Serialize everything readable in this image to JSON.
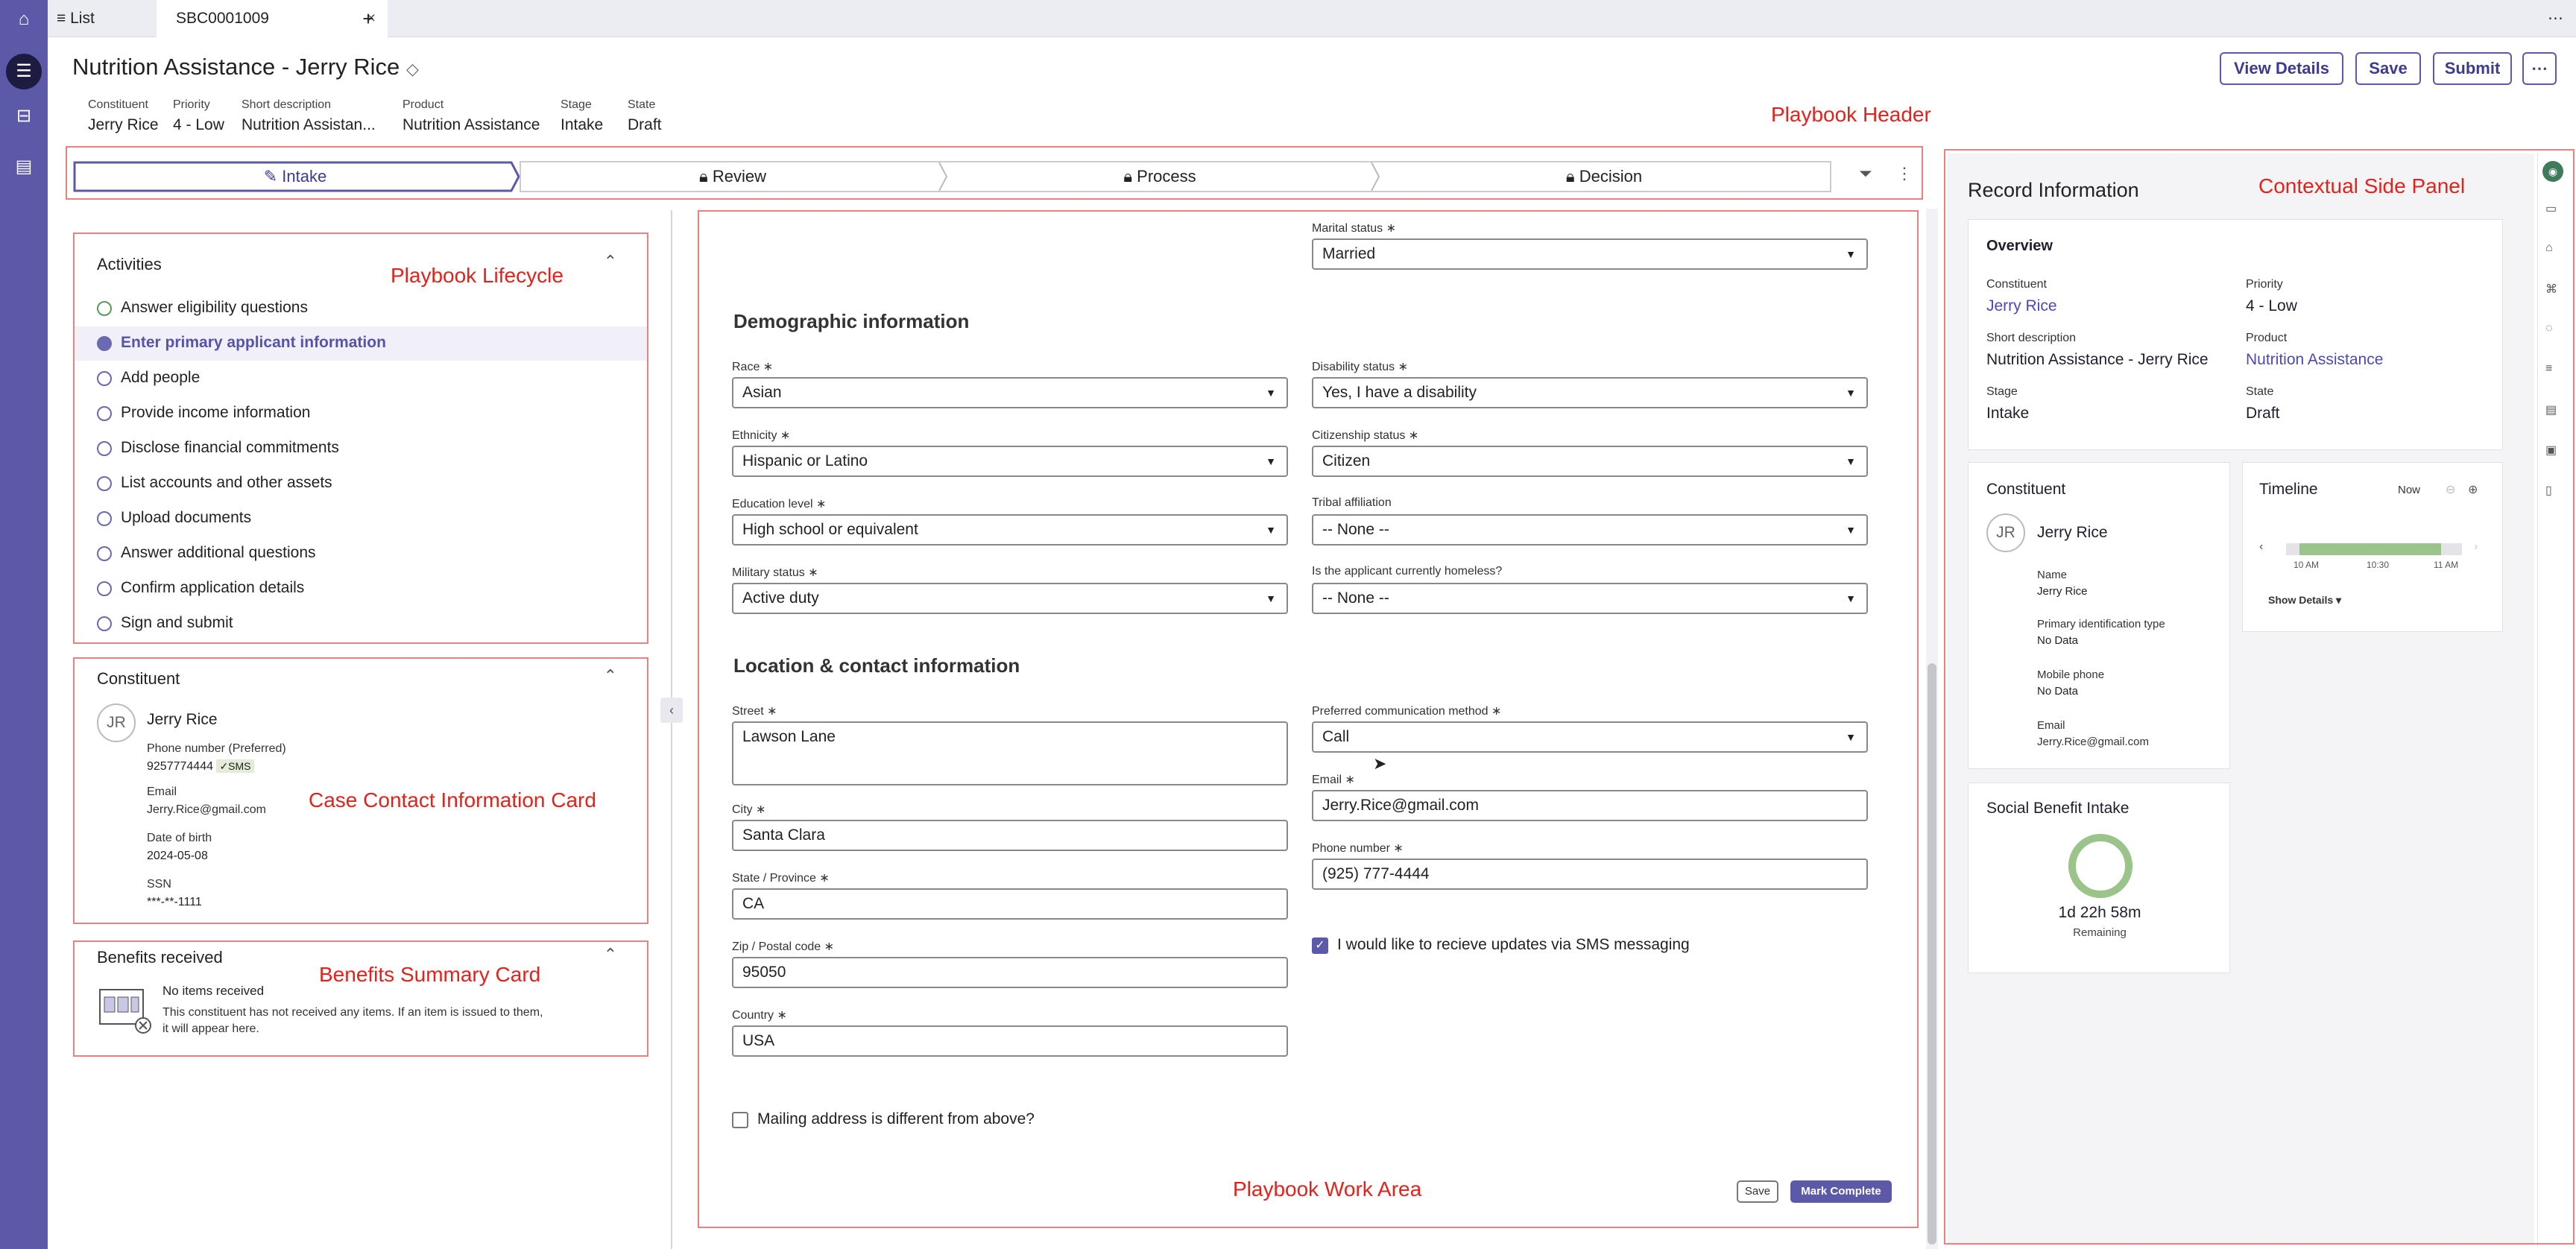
{
  "tabs": {
    "list": "List",
    "record": "SBC0001009",
    "close": "×",
    "add": "+",
    "more": "⋯"
  },
  "header": {
    "title": "Nutrition Assistance - Jerry Rice",
    "buttons": {
      "view_details": "View Details",
      "save": "Save",
      "submit": "Submit",
      "more": "⋯"
    },
    "meta": [
      {
        "label": "Constituent",
        "value": "Jerry Rice",
        "link": true
      },
      {
        "label": "Priority",
        "value": "4 - Low",
        "link": false
      },
      {
        "label": "Short description",
        "value": "Nutrition Assistan...",
        "link": false
      },
      {
        "label": "Product",
        "value": "Nutrition Assistance",
        "link": true
      },
      {
        "label": "Stage",
        "value": "Intake",
        "link": false
      },
      {
        "label": "State",
        "value": "Draft",
        "link": false
      }
    ]
  },
  "annotations": {
    "playbook_header": "Playbook Header",
    "lifecycle": "Playbook Lifecycle",
    "contact_card": "Case Contact Information Card",
    "benefits_card": "Benefits Summary Card",
    "work_area": "Playbook Work Area",
    "side_panel": "Contextual Side Panel"
  },
  "stages": [
    "Intake",
    "Review",
    "Process",
    "Decision"
  ],
  "activities": {
    "title": "Activities",
    "items": [
      "Answer eligibility questions",
      "Enter primary applicant information",
      "Add people",
      "Provide income information",
      "Disclose financial commitments",
      "List accounts and other assets",
      "Upload documents",
      "Answer additional questions",
      "Confirm application details",
      "Sign and submit"
    ]
  },
  "constituent_card": {
    "title": "Constituent",
    "initials": "JR",
    "name": "Jerry Rice",
    "phone_label": "Phone number (Preferred)",
    "phone": "9257774444",
    "sms": "SMS",
    "email_label": "Email",
    "email": "Jerry.Rice@gmail.com",
    "dob_label": "Date of birth",
    "dob": "2024-05-08",
    "ssn_label": "SSN",
    "ssn": "***-**-1111"
  },
  "benefits_card": {
    "title": "Benefits received",
    "empty_title": "No items received",
    "empty_text": "This constituent has not received any items. If an item is issued to them, it will appear here."
  },
  "form": {
    "marital_label": "Marital status",
    "marital": "Married",
    "demo_title": "Demographic information",
    "race_label": "Race",
    "race": "Asian",
    "disability_label": "Disability status",
    "disability": "Yes, I have a disability",
    "ethnicity_label": "Ethnicity",
    "ethnicity": "Hispanic or Latino",
    "citizenship_label": "Citizenship status",
    "citizenship": "Citizen",
    "education_label": "Education level",
    "education": "High school or equivalent",
    "tribal_label": "Tribal affiliation",
    "tribal": "-- None --",
    "military_label": "Military status",
    "military": "Active duty",
    "homeless_label": "Is the applicant currently homeless?",
    "homeless": "-- None --",
    "loc_title": "Location & contact information",
    "street_label": "Street",
    "street": "Lawson Lane",
    "pref_label": "Preferred communication method",
    "pref": "Call",
    "email_label": "Email",
    "email": "Jerry.Rice@gmail.com",
    "city_label": "City",
    "city": "Santa Clara",
    "phone_label": "Phone number",
    "phone": "(925) 777-4444",
    "state_label": "State / Province",
    "state": "CA",
    "sms_opt": "I would like to recieve updates via SMS messaging",
    "zip_label": "Zip / Postal code",
    "zip": "95050",
    "country_label": "Country",
    "country": "USA",
    "mailing": "Mailing address is different from above?",
    "save": "Save",
    "complete": "Mark Complete"
  },
  "side": {
    "title": "Record Information",
    "overview": "Overview",
    "fields": [
      {
        "label": "Constituent",
        "value": "Jerry Rice",
        "link": true
      },
      {
        "label": "Priority",
        "value": "4 - Low",
        "link": false
      },
      {
        "label": "Short description",
        "value": "Nutrition Assistance - Jerry Rice",
        "link": false
      },
      {
        "label": "Product",
        "value": "Nutrition Assistance",
        "link": true
      },
      {
        "label": "Stage",
        "value": "Intake",
        "link": false
      },
      {
        "label": "State",
        "value": "Draft",
        "link": false
      }
    ],
    "constituent": {
      "title": "Constituent",
      "initials": "JR",
      "name": "Jerry Rice",
      "name_label": "Name",
      "name_value": "Jerry Rice",
      "pid_label": "Primary identification type",
      "pid": "No Data",
      "mobile_label": "Mobile phone",
      "mobile": "No Data",
      "email_label": "Email",
      "email": "Jerry.Rice@gmail.com"
    },
    "timeline": {
      "title": "Timeline",
      "now": "Now",
      "ticks": [
        "10 AM",
        "10:30",
        "11 AM"
      ],
      "show": "Show Details"
    },
    "intake": {
      "title": "Social Benefit Intake",
      "time": "1d 22h 58m",
      "remaining": "Remaining"
    }
  },
  "colors": {
    "accent": "#5b59a8",
    "annotation": "#e2221b",
    "link": "#4b49b8",
    "timeline_bar": "#9bc48a"
  }
}
